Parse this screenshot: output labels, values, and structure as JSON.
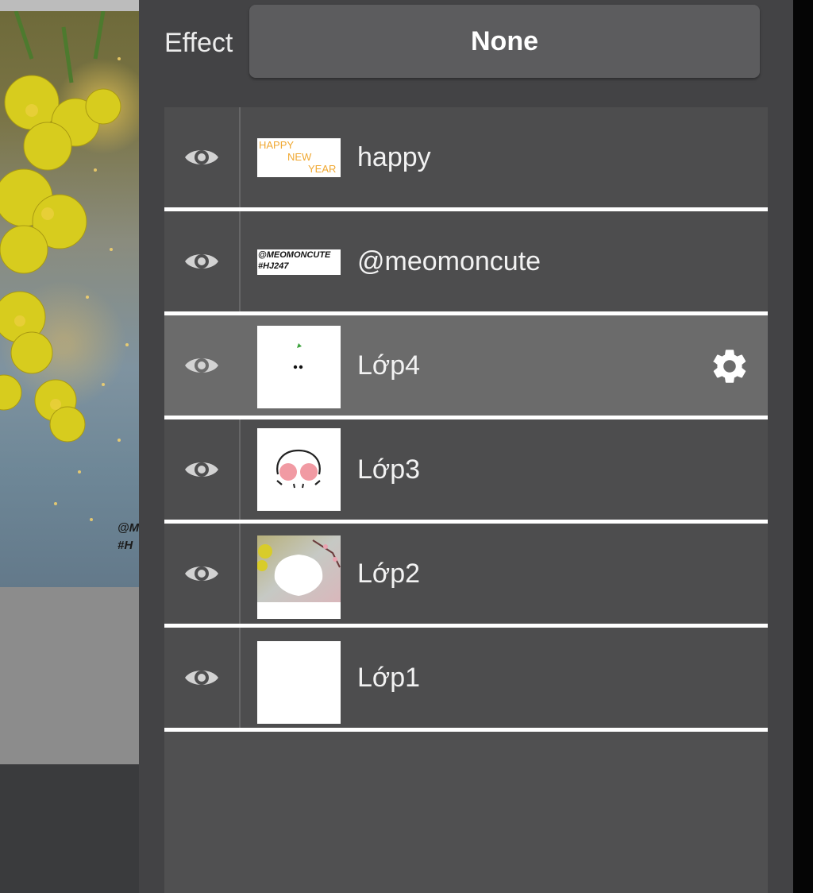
{
  "effect": {
    "label": "Effect",
    "value": "None"
  },
  "canvas": {
    "watermark_partial": "@M\n#H"
  },
  "layers": [
    {
      "name": "happy",
      "thumb_lines": [
        "HAPPY",
        "NEW",
        "YEAR"
      ],
      "visible": true,
      "selected": false
    },
    {
      "name": "@meomoncute",
      "thumb_lines": [
        "@MEOMONCUTE",
        "#HJ247"
      ],
      "visible": true,
      "selected": false
    },
    {
      "name": "Lớp4",
      "visible": true,
      "selected": true
    },
    {
      "name": "Lớp3",
      "visible": true,
      "selected": false
    },
    {
      "name": "Lớp2",
      "visible": true,
      "selected": false
    },
    {
      "name": "Lớp1",
      "visible": true,
      "selected": false
    }
  ],
  "colors": {
    "panel": "#434345",
    "row": "#4d4d4e",
    "row_selected": "#6b6b6b",
    "separator": "#ffffff",
    "happy_text": "#f0a832"
  },
  "icons": {
    "visibility": "eye-icon",
    "settings": "gear-icon"
  }
}
